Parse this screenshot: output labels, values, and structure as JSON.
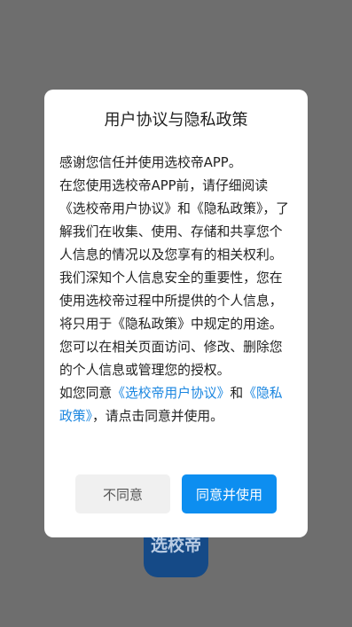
{
  "app_icon": {
    "label": "选校帝",
    "color": "#154a87"
  },
  "dialog": {
    "title": "用户协议与隐私政策",
    "paragraph_1": "感谢您信任并使用选校帝APP。",
    "paragraph_2": "在您使用选校帝APP前，请仔细阅读《选校帝用户协议》和《隐私政策》，了解我们在收集、使用、存储和共享您个人信息的情况以及您享有的相关权利。",
    "paragraph_3": "我们深知个人信息安全的重要性，您在使用选校帝过程中所提供的个人信息，将只用于《隐私政策》中规定的用途。您可以在相关页面访问、修改、删除您的个人信息或管理您的授权。",
    "paragraph_4": {
      "prefix": "如您同意",
      "user_agreement_link": "《选校帝用户协议》",
      "and": "和",
      "privacy_policy_link": "《隐私政策》",
      "suffix": "，请点击同意并使用。"
    },
    "disagree_label": "不同意",
    "agree_label": "同意并使用"
  },
  "colors": {
    "overlay": "#6e6e6e",
    "link": "#1a86e0",
    "primary_button": "#0d8ef0",
    "secondary_button": "#f0f0f0"
  }
}
